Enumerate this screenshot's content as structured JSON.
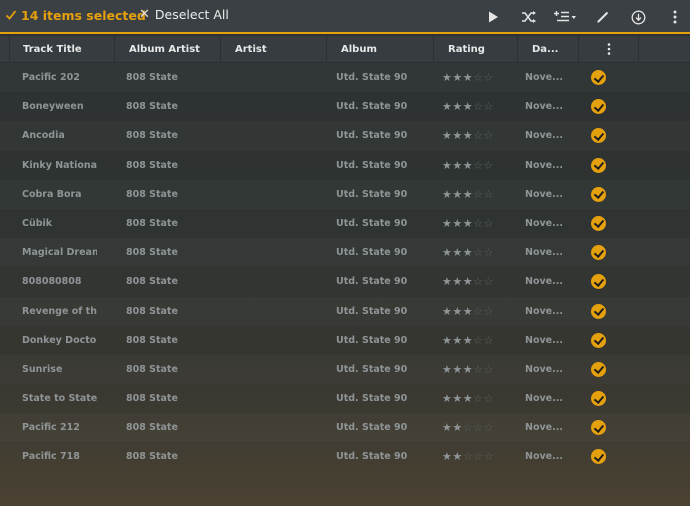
{
  "selection": {
    "count_label": "14 items selected",
    "deselect_label": "Deselect All"
  },
  "toolbar": {
    "icons": [
      "play-icon",
      "shuffle-icon",
      "add-to-queue-icon",
      "edit-icon",
      "download-icon",
      "more-vertical-icon"
    ]
  },
  "columns": {
    "title": "Track Title",
    "album_artist": "Album Artist",
    "artist": "Artist",
    "album": "Album",
    "rating": "Rating",
    "date": "Da..."
  },
  "colors": {
    "accent": "#e5a00d",
    "text": "#8f9597"
  },
  "tracks": [
    {
      "title": "Pacific 202",
      "album_artist": "808 State",
      "artist": "",
      "album": "Utd. State 90",
      "rating": 3,
      "date": "Nove...",
      "selected": true
    },
    {
      "title": "Boneyween",
      "album_artist": "808 State",
      "artist": "",
      "album": "Utd. State 90",
      "rating": 3,
      "date": "Nove...",
      "selected": true
    },
    {
      "title": "Ancodia",
      "album_artist": "808 State",
      "artist": "",
      "album": "Utd. State 90",
      "rating": 3,
      "date": "Nove...",
      "selected": true
    },
    {
      "title": "Kinky National",
      "album_artist": "808 State",
      "artist": "",
      "album": "Utd. State 90",
      "rating": 3,
      "date": "Nove...",
      "selected": true
    },
    {
      "title": "Cobra Bora",
      "album_artist": "808 State",
      "artist": "",
      "album": "Utd. State 90",
      "rating": 3,
      "date": "Nove...",
      "selected": true
    },
    {
      "title": "Cübik",
      "album_artist": "808 State",
      "artist": "",
      "album": "Utd. State 90",
      "rating": 3,
      "date": "Nove...",
      "selected": true
    },
    {
      "title": "Magical Dream",
      "album_artist": "808 State",
      "artist": "",
      "album": "Utd. State 90",
      "rating": 3,
      "date": "Nove...",
      "selected": true
    },
    {
      "title": "808080808",
      "album_artist": "808 State",
      "artist": "",
      "album": "Utd. State 90",
      "rating": 3,
      "date": "Nove...",
      "selected": true
    },
    {
      "title": "Revenge of th...",
      "album_artist": "808 State",
      "artist": "",
      "album": "Utd. State 90",
      "rating": 3,
      "date": "Nove...",
      "selected": true
    },
    {
      "title": "Donkey Doctor",
      "album_artist": "808 State",
      "artist": "",
      "album": "Utd. State 90",
      "rating": 3,
      "date": "Nove...",
      "selected": true
    },
    {
      "title": "Sunrise",
      "album_artist": "808 State",
      "artist": "",
      "album": "Utd. State 90",
      "rating": 3,
      "date": "Nove...",
      "selected": true
    },
    {
      "title": "State to State",
      "album_artist": "808 State",
      "artist": "",
      "album": "Utd. State 90",
      "rating": 3,
      "date": "Nove...",
      "selected": true
    },
    {
      "title": "Pacific 212",
      "album_artist": "808 State",
      "artist": "",
      "album": "Utd. State 90",
      "rating": 2,
      "date": "Nove...",
      "selected": true
    },
    {
      "title": "Pacific 718",
      "album_artist": "808 State",
      "artist": "",
      "album": "Utd. State 90",
      "rating": 2,
      "date": "Nove...",
      "selected": true
    }
  ]
}
